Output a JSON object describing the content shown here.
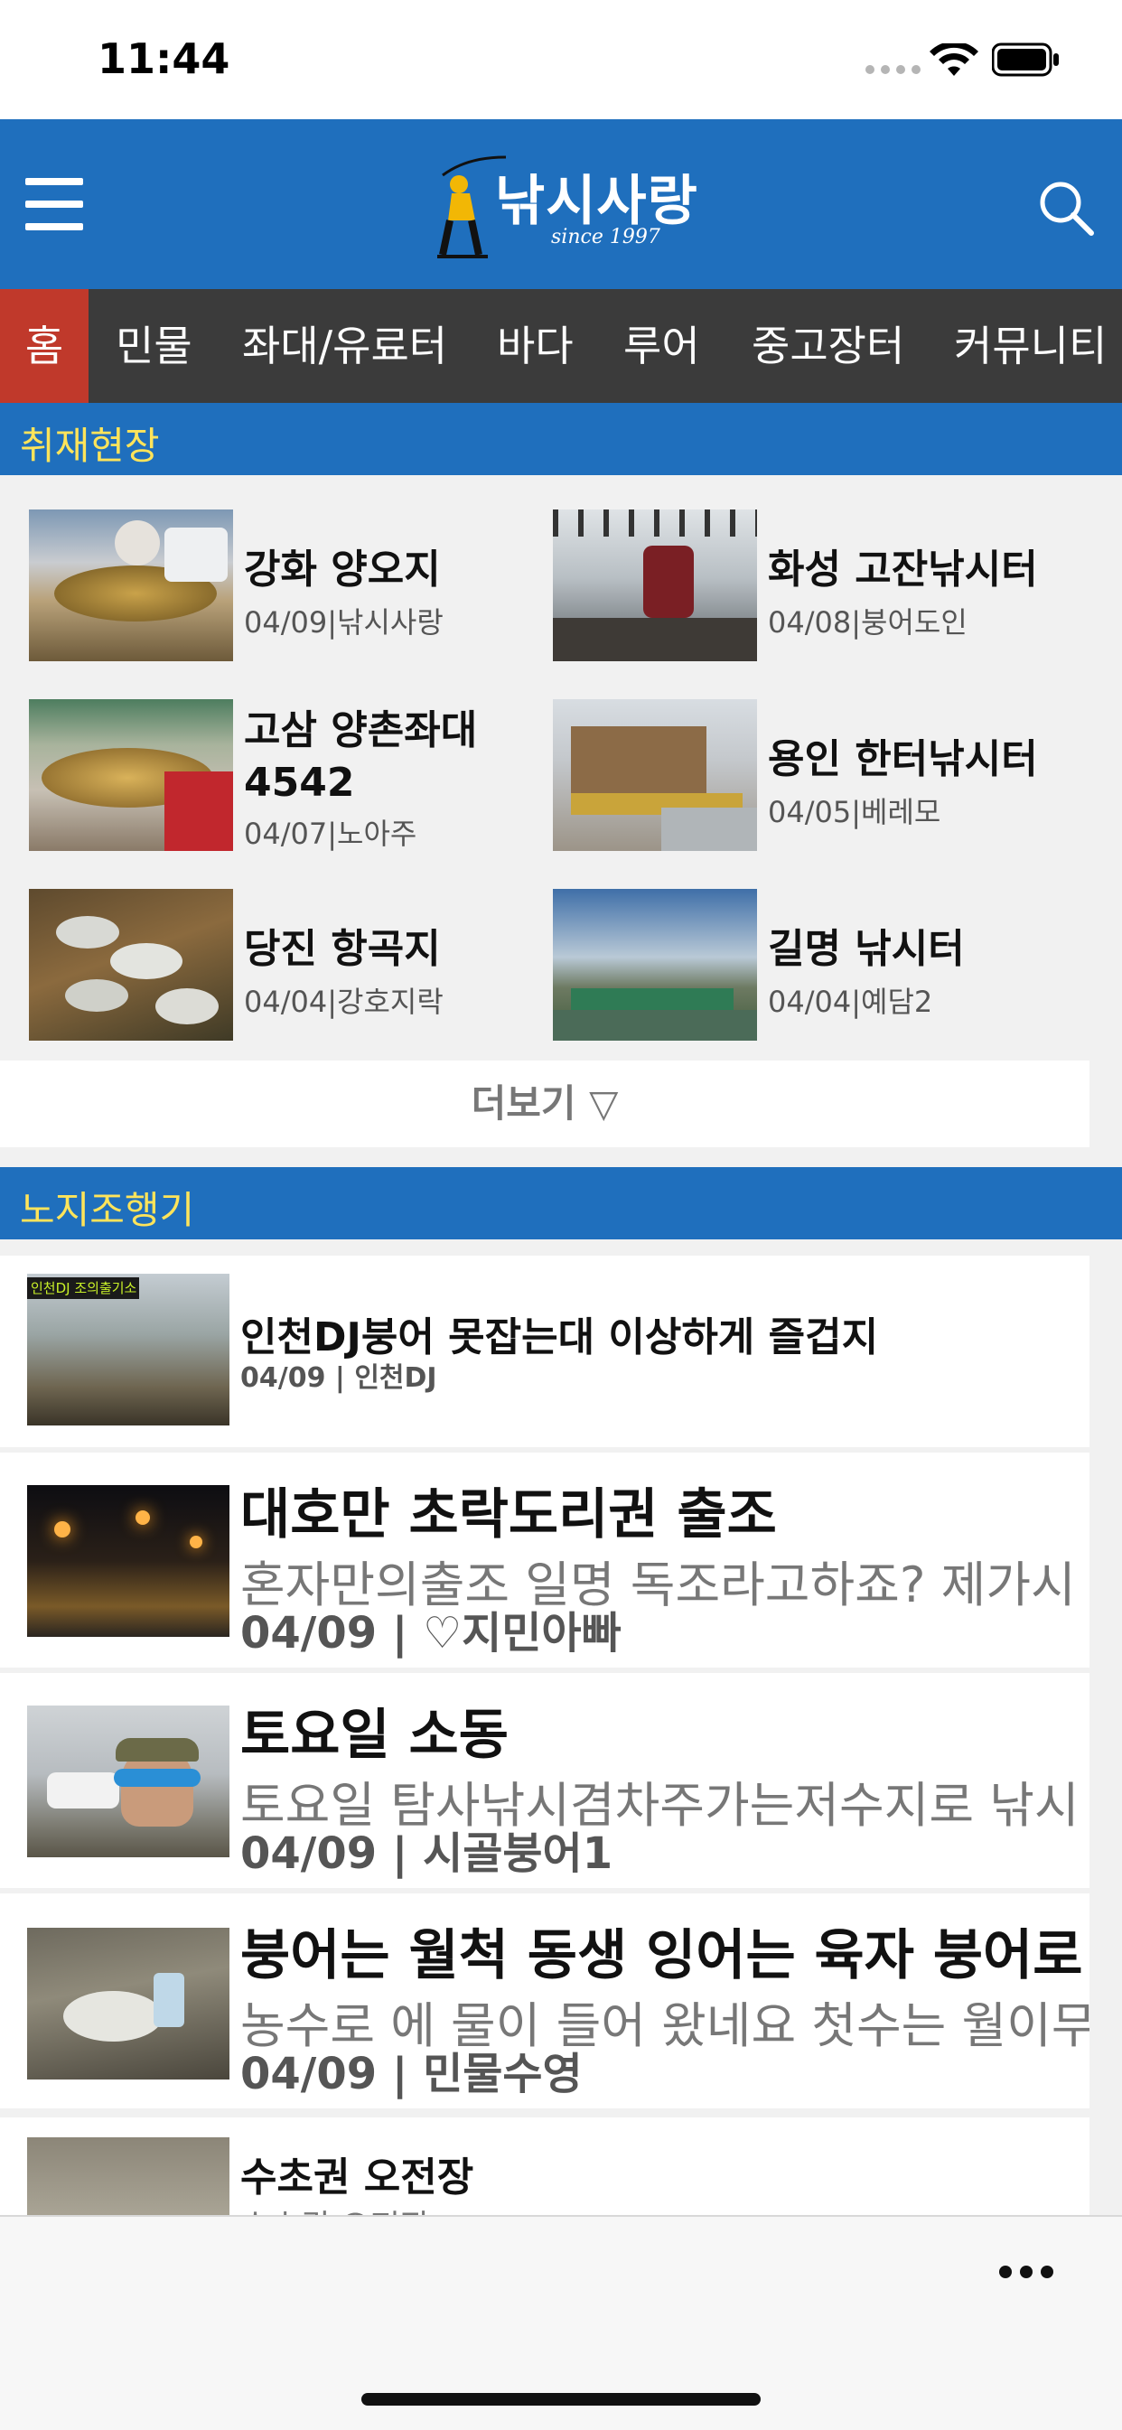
{
  "status_bar": {
    "time": "11:44"
  },
  "header": {
    "logo_text": "낚시사랑",
    "logo_since": "since 1997",
    "accent_color": "#1f6fbd"
  },
  "tabs": [
    "홈",
    "민물",
    "좌대/유료터",
    "바다",
    "루어",
    "중고장터",
    "커뮤니티"
  ],
  "active_tab": "홈",
  "reports": {
    "section_title": "취재현장",
    "items": [
      {
        "title": "강화 양오지",
        "meta": "04/09|낚시사랑"
      },
      {
        "title": "화성 고잔낚시터",
        "meta": "04/08|붕어도인"
      },
      {
        "title": "고삼 양촌좌대 4542",
        "meta": "04/07|노아주"
      },
      {
        "title": "용인 한터낚시터",
        "meta": "04/05|베레모"
      },
      {
        "title": "당진 항곡지",
        "meta": "04/04|강호지락"
      },
      {
        "title": "길명 낚시터",
        "meta": "04/04|예담2"
      }
    ],
    "more_label": "더보기 ▽"
  },
  "diary": {
    "section_title": "노지조행기",
    "thumb_caption": "인천DJ  조의출기소",
    "items": [
      {
        "title": "인천DJ붕어 못잡는대 이상하게 즐겁지",
        "summary": "",
        "date": "04/09",
        "author": "인천DJ"
      },
      {
        "title": "대호만 초락도리권 출조",
        "summary": "혼자만의출조 일명 독조라고하죠? 제가시",
        "date": "04/09",
        "author": "♡지민아빠"
      },
      {
        "title": "토요일 소동",
        "summary": "토요일 탐사낚시겸차주가는저수지로 낚시",
        "date": "04/09",
        "author": "시골붕어1"
      },
      {
        "title": "붕어는 월척 동생 잉어는 육자 붕어로",
        "summary": "농수로 에 물이 들어 왔네요 첫수는 월이무",
        "date": "04/09",
        "author": "민물수영"
      },
      {
        "title": "수초권 오전장",
        "summary": "수초권 오전장",
        "date": "",
        "author": ""
      }
    ]
  }
}
